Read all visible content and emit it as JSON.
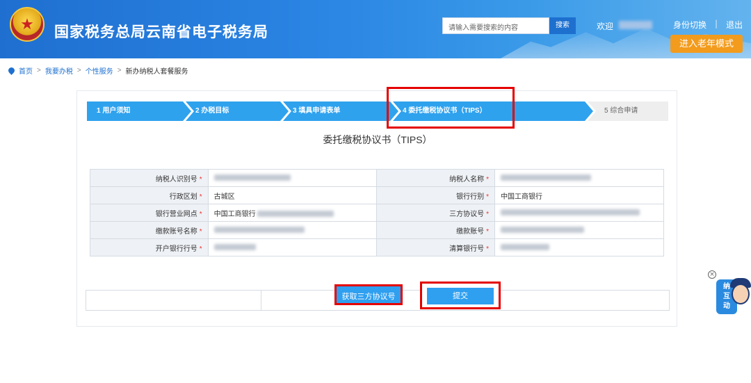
{
  "header": {
    "site_title": "国家税务总局云南省电子税务局",
    "search_placeholder": "请输入需要搜索的内容",
    "search_button": "搜索",
    "welcome": "欢迎",
    "switch_identity": "身份切换",
    "separator": "|",
    "logout": "退出",
    "elder_mode": "进入老年模式"
  },
  "breadcrumb": {
    "items": [
      "首页",
      "我要办税",
      "个性服务",
      "新办纳税人套餐服务"
    ],
    "separator": ">"
  },
  "steps": [
    {
      "label": "1 用户须知",
      "state": "done"
    },
    {
      "label": "2 办税目标",
      "state": "done"
    },
    {
      "label": "3 填具申请表单",
      "state": "done"
    },
    {
      "label": "4 委托缴税协议书（TIPS）",
      "state": "current"
    },
    {
      "label": "5 综合申请",
      "state": "pending"
    }
  ],
  "section_title": "委托缴税协议书（TIPS）",
  "form": {
    "rows": [
      {
        "left_label": "纳税人识别号",
        "left_value": "",
        "right_label": "纳税人名称",
        "right_value": ""
      },
      {
        "left_label": "行政区划",
        "left_value": "古城区",
        "right_label": "银行行别",
        "right_value": "中国工商银行"
      },
      {
        "left_label": "银行营业网点",
        "left_value": "中国工商银行",
        "right_label": "三方协议号",
        "right_value": ""
      },
      {
        "left_label": "缴款账号名称",
        "left_value": "",
        "right_label": "缴款账号",
        "right_value": ""
      },
      {
        "left_label": "开户银行行号",
        "left_value": "",
        "right_label": "清算银行号",
        "right_value": ""
      }
    ],
    "required_mark": "*"
  },
  "buttons": {
    "get_agreement_no": "获取三方协议号",
    "submit": "提交"
  },
  "mascot": {
    "text": "纳\n互\n动",
    "badge": "征",
    "close_glyph": "×"
  },
  "colors": {
    "header_blue": "#1f6fd0",
    "step_active": "#2fa2ee",
    "highlight_red": "#e50000",
    "elder_orange": "#f39b1c"
  }
}
